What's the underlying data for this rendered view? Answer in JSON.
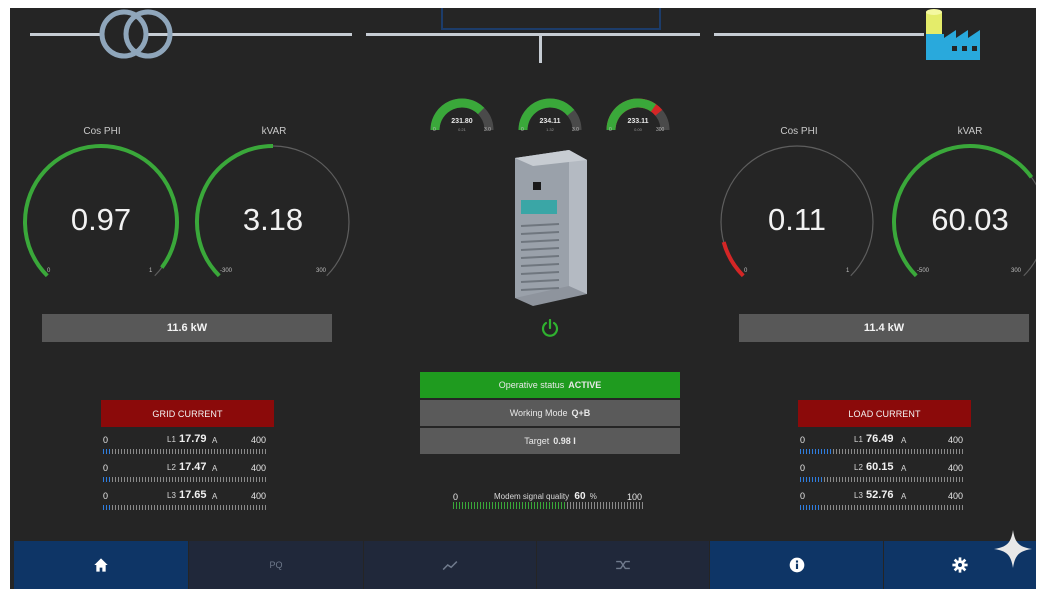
{
  "colors": {
    "background": "#252525",
    "gauge_green": "#3aa83a",
    "gauge_red": "#d42626",
    "gauge_track": "#6b6b6b",
    "header_red": "#8b0a0a",
    "status_green": "#1f9b1f",
    "status_gray": "#5a5a5a",
    "nav_active": "#0e3566",
    "nav_inactive": "#20283a",
    "bar_blue": "#2f7ee0"
  },
  "top_diagram": {
    "grid_icon": "transformer-icon",
    "load_icon": "factory-icon"
  },
  "grid": {
    "cos_phi": {
      "label": "Cos PHI",
      "value": "0.97",
      "min": "0",
      "max": "1",
      "level": 0.97,
      "color": "green"
    },
    "kvar": {
      "label": "kVAR",
      "value": "3.18",
      "min": "-300",
      "max": "300",
      "level": 0.5,
      "color": "green"
    },
    "power": "11.6 kW",
    "current_header": "GRID CURRENT",
    "currents": [
      {
        "phase": "L1",
        "value": "17.79",
        "unit": "A",
        "min": "0",
        "max": "400",
        "level": 0.044
      },
      {
        "phase": "L2",
        "value": "17.47",
        "unit": "A",
        "min": "0",
        "max": "400",
        "level": 0.044
      },
      {
        "phase": "L3",
        "value": "17.65",
        "unit": "A",
        "min": "0",
        "max": "400",
        "level": 0.044
      }
    ]
  },
  "load": {
    "cos_phi": {
      "label": "Cos PHI",
      "value": "0.11",
      "min": "0",
      "max": "1",
      "level": 0.11,
      "color": "red"
    },
    "kvar": {
      "label": "kVAR",
      "value": "60.03",
      "min": "-500",
      "max": "300",
      "level": 0.7,
      "color": "green"
    },
    "power": "11.4 kW",
    "current_header": "LOAD CURRENT",
    "currents": [
      {
        "phase": "L1",
        "value": "76.49",
        "unit": "A",
        "min": "0",
        "max": "400",
        "level": 0.19
      },
      {
        "phase": "L2",
        "value": "60.15",
        "unit": "A",
        "min": "0",
        "max": "400",
        "level": 0.15
      },
      {
        "phase": "L3",
        "value": "52.76",
        "unit": "A",
        "min": "0",
        "max": "400",
        "level": 0.13
      }
    ]
  },
  "voltage_gauges": [
    {
      "value": "231.80",
      "sub": "0.21",
      "min": "0",
      "max": "3.0",
      "level": 0.75,
      "color": "green"
    },
    {
      "value": "234.11",
      "sub": "1.32",
      "min": "0",
      "max": "3.0",
      "level": 0.78,
      "color": "green"
    },
    {
      "value": "233.11",
      "sub": "0.00",
      "min": "0",
      "max": "300",
      "level": 0.78,
      "color": "red"
    }
  ],
  "device": {
    "name": "cabinet-icon",
    "power_icon": "power-icon"
  },
  "status": {
    "operative_label": "Operative status",
    "operative_value": "ACTIVE",
    "mode_label": "Working Mode",
    "mode_value": "Q+B",
    "target_label": "Target",
    "target_value": "0.98 I"
  },
  "modem": {
    "label": "Modem signal quality",
    "value": "60",
    "unit": "%",
    "min": "0",
    "max": "100",
    "level": 0.6
  },
  "nav": [
    {
      "icon": "home-icon",
      "label": "",
      "active": true
    },
    {
      "icon": "",
      "label": "PQ",
      "active": false
    },
    {
      "icon": "trend-icon",
      "label": "",
      "active": false
    },
    {
      "icon": "shuffle-icon",
      "label": "",
      "active": false
    },
    {
      "icon": "info-icon",
      "label": "",
      "active": true
    },
    {
      "icon": "gear-icon",
      "label": "",
      "active": true
    }
  ]
}
